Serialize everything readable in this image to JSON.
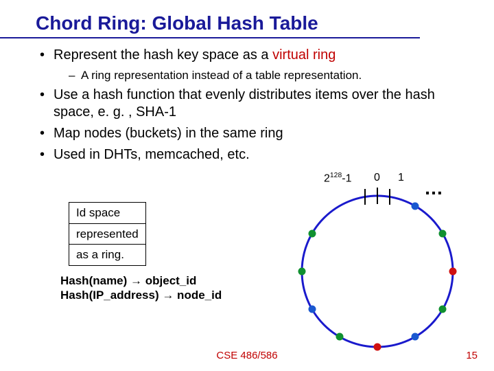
{
  "title": "Chord Ring: Global Hash Table",
  "bullets": {
    "b1_pre": "Represent the hash key space as a ",
    "b1_em": "virtual ring",
    "b1_sub": "A ring representation instead of a table representation.",
    "b2": "Use a hash function that evenly distributes items over the hash space, e. g. , SHA-1",
    "b3": "Map nodes (buckets) in the same ring",
    "b4": "Used in DHTs, memcached, etc."
  },
  "idbox": {
    "l1": "Id space",
    "l2": "represented",
    "l3": "as a ring."
  },
  "hash": {
    "l1": "Hash(name) → object_id",
    "l2": "Hash(IP_address) → node_id"
  },
  "ring": {
    "label_max_base": "2",
    "label_max_exp": "128",
    "label_max_suffix": "-1",
    "label_zero": "0",
    "label_one": "1",
    "ellipsis": "…"
  },
  "footer": "CSE 486/586",
  "pagenum": "15",
  "colors": {
    "ring_stroke": "#1a1acc",
    "node_red": "#d01010",
    "node_blue": "#1a58d0",
    "node_green": "#109030"
  }
}
